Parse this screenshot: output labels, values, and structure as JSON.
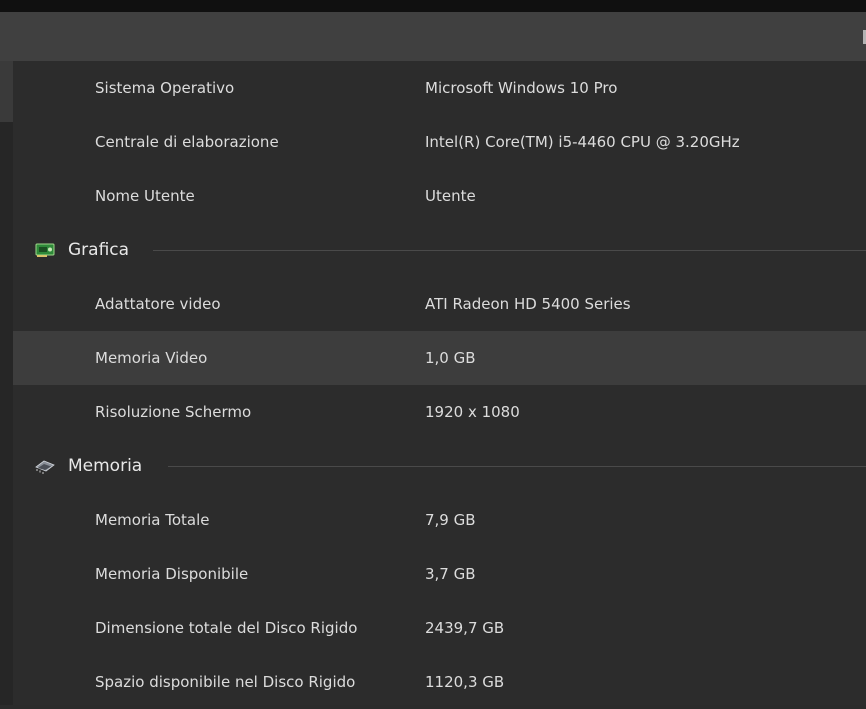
{
  "system": {
    "rows": [
      {
        "label": "Sistema Operativo",
        "value": "Microsoft Windows 10 Pro"
      },
      {
        "label": "Centrale di elaborazione",
        "value": "Intel(R) Core(TM) i5-4460  CPU @ 3.20GHz"
      },
      {
        "label": "Nome Utente",
        "value": "Utente"
      }
    ]
  },
  "graphics": {
    "title": "Grafica",
    "icon": "graphics-card-icon",
    "rows": [
      {
        "label": "Adattatore video",
        "value": "ATI Radeon HD 5400 Series"
      },
      {
        "label": "Memoria Video",
        "value": "1,0 GB"
      },
      {
        "label": "Risoluzione Schermo",
        "value": "1920 x 1080"
      }
    ]
  },
  "memory": {
    "title": "Memoria",
    "icon": "memory-chip-icon",
    "rows": [
      {
        "label": "Memoria Totale",
        "value": "7,9 GB"
      },
      {
        "label": "Memoria Disponibile",
        "value": "3,7 GB"
      },
      {
        "label": "Dimensione totale del Disco Rigido",
        "value": "2439,7 GB"
      },
      {
        "label": "Spazio disponibile nel Disco Rigido",
        "value": "1120,3 GB"
      }
    ]
  },
  "colors": {
    "background": "#2c2c2c",
    "selected_row": "#3d3d3d",
    "title_bar": "#404040",
    "text": "#dcdcdc"
  }
}
